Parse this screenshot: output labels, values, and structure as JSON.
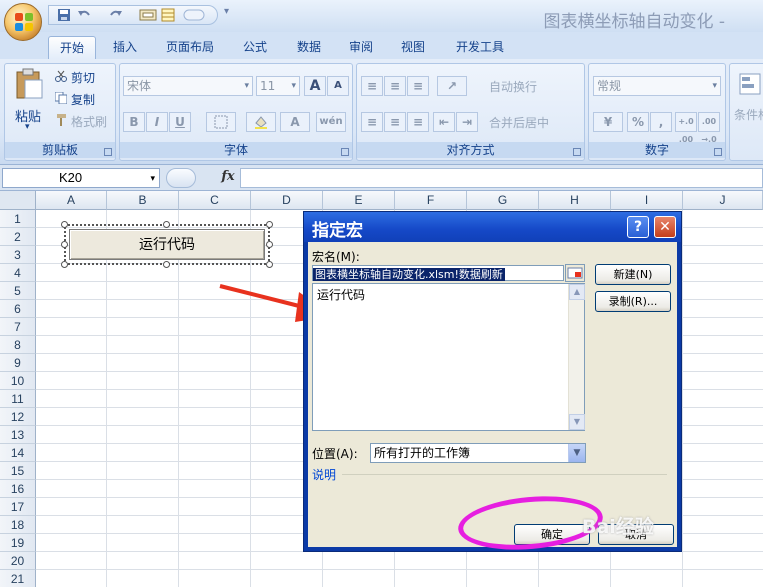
{
  "window": {
    "title": "图表横坐标轴自动变化 -"
  },
  "tabs": [
    "开始",
    "插入",
    "页面布局",
    "公式",
    "数据",
    "审阅",
    "视图",
    "开发工具"
  ],
  "ribbon": {
    "clipboard": {
      "label": "剪贴板",
      "paste": "粘贴",
      "cut": "剪切",
      "copy": "复制",
      "format_painter": "格式刷"
    },
    "font": {
      "label": "字体",
      "name": "宋体",
      "size": "11",
      "grow": "A",
      "shrink": "A",
      "bold": "B",
      "italic": "I",
      "underline": "U",
      "phonetic": "wén"
    },
    "alignment": {
      "label": "对齐方式",
      "wrap": "自动换行",
      "merge": "合并后居中"
    },
    "number": {
      "label": "数字",
      "format": "常规",
      "percent": "%",
      "comma": ",",
      "inc": "+.0 .00",
      "dec": ".00 →.0"
    },
    "styles": {
      "partial": "条件格"
    }
  },
  "formula_bar": {
    "name_box": "K20",
    "fx": "fx",
    "content": ""
  },
  "sheet": {
    "columns": [
      "A",
      "B",
      "C",
      "D",
      "E",
      "F",
      "G",
      "H",
      "I",
      "J"
    ],
    "rows": [
      "1",
      "2",
      "3",
      "4",
      "5",
      "6",
      "7",
      "8",
      "9",
      "10",
      "11",
      "12",
      "13",
      "14",
      "15",
      "16",
      "17",
      "18",
      "19",
      "20",
      "21"
    ],
    "form_button_label": "运行代码"
  },
  "dialog": {
    "title": "指定宏",
    "help": "?",
    "close": "✕",
    "macro_name_label": "宏名(M):",
    "macro_name_value": "图表横坐标轴自动变化.xlsm!数据刷新",
    "macro_list": [
      "运行代码"
    ],
    "new_button": "新建(N)",
    "record_button": "录制(R)...",
    "location_label": "位置(A):",
    "location_value": "所有打开的工作簿",
    "description_label": "说明",
    "ok_button": "确定",
    "cancel_button": "取消"
  },
  "overlay": {
    "watermark": "Bai经验"
  },
  "colors": {
    "annotation_arrow": "#e8321e",
    "annotation_ellipse": "#e61fe0",
    "dialog_title": "#1548c7"
  }
}
